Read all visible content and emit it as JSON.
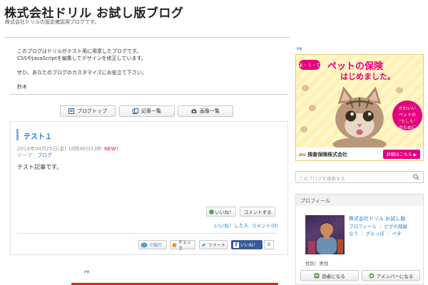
{
  "header": {
    "title": "株式会社ドリル お試し版ブログ",
    "subtitle": "株式会社ドリルの設定確認用ブログです。"
  },
  "intro": {
    "lines": [
      "このブログはドリルがテスト用に用意したブログです。",
      "CSSやJavaScriptを編集してデザインを修正しています。",
      "",
      "ぜひ、あなたのブログのカスタマイズにお役立て下さい。",
      "",
      "鈴木"
    ]
  },
  "nav": {
    "blog_top": "ブログトップ",
    "articles": "記事一覧",
    "images": "画像一覧"
  },
  "post": {
    "title": "テスト１",
    "datetime": "2014年04月25日(金) 18時46分53秒",
    "new_badge": "NEW！",
    "theme_label": "テーマ：",
    "theme_value": "ブログ",
    "body": "テスト記事です。",
    "like_button": "いいね！",
    "comment_button": "コメントする",
    "liked_by_link": "いいね！した人",
    "link_sep": "｜",
    "comments_link": "コメント(0)"
  },
  "share": {
    "introduce": "で紹介",
    "check": "チェック",
    "tweet": "ツイート",
    "fb_like": "いいね！",
    "fb_count": "0"
  },
  "pr_label": "PR",
  "ad": {
    "badge": "あ・う・て",
    "title": "ペットの保険",
    "subtitle": "はじめました。",
    "circle_line1": "かわいい",
    "circle_line2": "ペットの",
    "circle_line3": "\"もしも\"",
    "circle_line4": "のために",
    "logo_au": "au",
    "logo_company": "損害保険株式会社",
    "cta": "詳細はこちら ▶"
  },
  "sidebar": {
    "search_placeholder": "このブログを検索する",
    "profile_title": "プロフィール",
    "profile_name": "株式会社ドリル お試し版",
    "profile_links": [
      "プロフィール",
      "ピグの部屋",
      "なう",
      "グルっぽ",
      "ペタ"
    ],
    "gender": "性別：男性",
    "reader_button": "読者になる",
    "amember_button": "アメンバーになる"
  },
  "colors": {
    "accent_link": "#2a7cc7",
    "new_pink": "#e5007f",
    "ad_pink": "#e5007f",
    "bottom_bar": "#e32323"
  }
}
